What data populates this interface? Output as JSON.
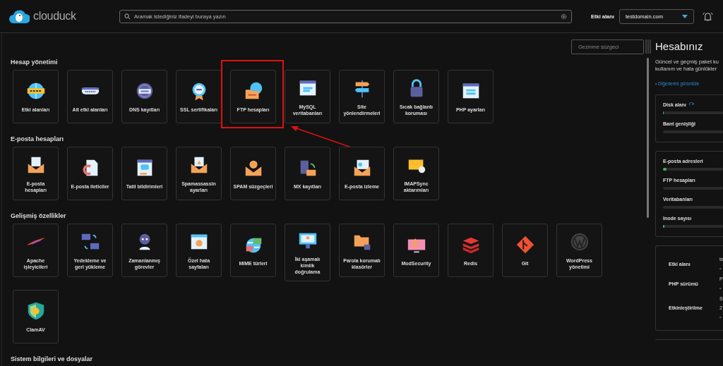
{
  "header": {
    "logo": "clouduck",
    "search": {
      "placeholder": "Aramak istediğiniz ifadeyi buraya yazın"
    },
    "domain_label": "Etki alanı",
    "domain_select": {
      "value": "testdomain.com"
    }
  },
  "filter": {
    "placeholder": "Gezinme süzgeci"
  },
  "sections": [
    {
      "title": "Hesap yönetimi",
      "tiles": [
        {
          "label": "Etki alanları",
          "highlighted": false
        },
        {
          "label": "Alt etki alanları",
          "highlighted": false
        },
        {
          "label": "DNS kayıtları",
          "highlighted": false
        },
        {
          "label": "SSL sertifikaları",
          "highlighted": false
        },
        {
          "label": "FTP hesapları",
          "highlighted": true
        },
        {
          "label": "MySQL veritabanları",
          "highlighted": false
        },
        {
          "label": "Site yönlendirmeleri",
          "highlighted": false
        },
        {
          "label": "Sıcak bağlantı koruması",
          "highlighted": false
        },
        {
          "label": "PHP ayarları",
          "highlighted": false
        }
      ]
    },
    {
      "title": "E-posta hesapları",
      "tiles": [
        {
          "label": "E-posta hesapları",
          "highlighted": false
        },
        {
          "label": "E-posta ileticiler",
          "highlighted": false
        },
        {
          "label": "Tatil bildirimleri",
          "highlighted": false
        },
        {
          "label": "Spamassassin ayarları",
          "highlighted": false
        },
        {
          "label": "SPAM süzgeçleri",
          "highlighted": false
        },
        {
          "label": "MX kayıtları",
          "highlighted": false
        },
        {
          "label": "E-posta izleme",
          "highlighted": false
        },
        {
          "label": "IMAPSync aktarımları",
          "highlighted": false
        }
      ]
    },
    {
      "title": "Gelişmiş özellikler",
      "tiles": [
        {
          "label": "Apache işleyicileri",
          "highlighted": false
        },
        {
          "label": "Yedekleme ve geri yükleme",
          "highlighted": false
        },
        {
          "label": "Zamanlanmış görevler",
          "highlighted": false
        },
        {
          "label": "Özel hata sayfaları",
          "highlighted": false
        },
        {
          "label": "MIME türleri",
          "highlighted": false
        },
        {
          "label": "İki aşamalı kimlik doğrulama",
          "highlighted": false
        },
        {
          "label": "Parola korumalı klasörler",
          "highlighted": false
        },
        {
          "label": "ModSecurity",
          "highlighted": false
        },
        {
          "label": "Redis",
          "highlighted": false
        },
        {
          "label": "Git",
          "highlighted": false
        },
        {
          "label": "WordPress yönetimi",
          "highlighted": false
        },
        {
          "label": "ClamAV",
          "highlighted": false
        }
      ]
    },
    {
      "title": "Sistem bilgileri ve dosyalar"
    }
  ],
  "account": {
    "title": "Hesabınız",
    "description_lines": [
      "Güncel ve geçmiş paket ku",
      "kullanım ve hata günlükler"
    ],
    "link": "• Diğerlerini görüntüle",
    "usage_cards": [
      {
        "metrics": [
          {
            "label": "Disk alanı",
            "refresh": true,
            "level": 0.01
          },
          {
            "label": "Bant genişliği",
            "refresh": false,
            "level": 0
          }
        ]
      },
      {
        "metrics": [
          {
            "label": "E-posta adresleri",
            "refresh": false,
            "level": 0.06
          },
          {
            "label": "FTP hesapları",
            "refresh": false,
            "level": 0
          },
          {
            "label": "Veritabanları",
            "refresh": false,
            "level": 0
          },
          {
            "label": "Inode sayısı",
            "refresh": false,
            "level": 0.02
          }
        ]
      }
    ],
    "info": [
      {
        "label": "Etki alanı",
        "value_lines": [
          "te"
        ],
        "bullet": "•"
      },
      {
        "label": "PHP sürümü",
        "value_lines": [
          "P"
        ],
        "bullet": "•"
      },
      {
        "label": "Etkinleştirilme",
        "value_lines": [
          "S",
          "2"
        ],
        "bullet": "•"
      }
    ]
  }
}
